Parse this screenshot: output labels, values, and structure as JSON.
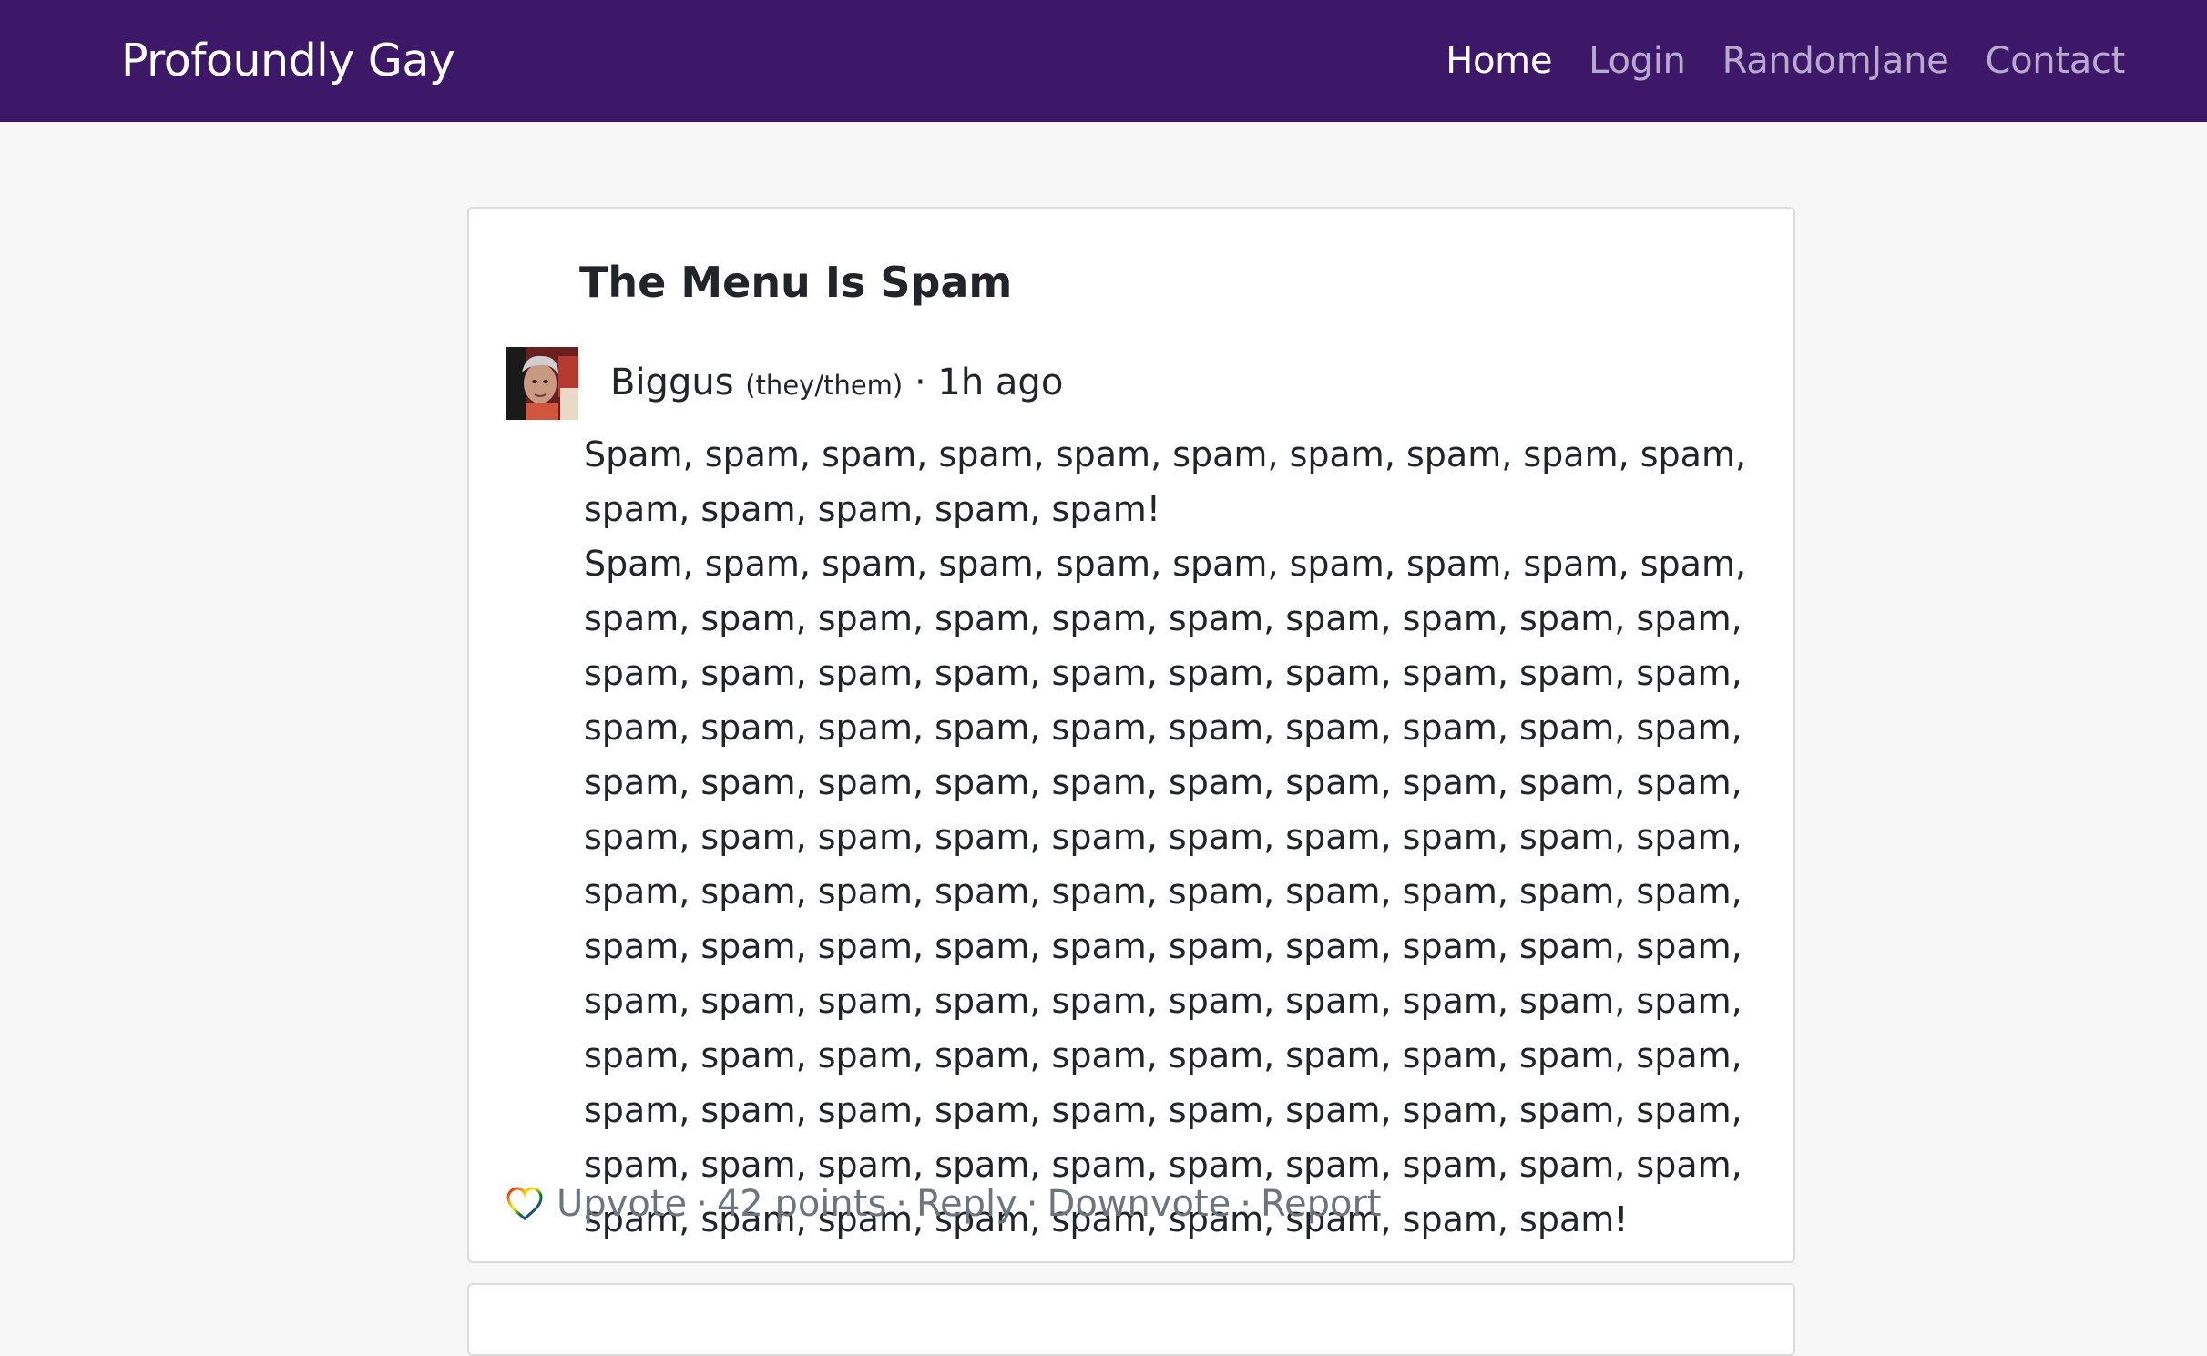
{
  "navbar": {
    "brand": "Profoundly Gay",
    "links": [
      {
        "label": "Home"
      },
      {
        "label": "Login"
      },
      {
        "label": "RandomJane"
      },
      {
        "label": "Contact"
      }
    ]
  },
  "post": {
    "title": "The Menu Is Spam",
    "author": "Biggus",
    "pronouns": "(they/them)",
    "time": "1h ago",
    "paragraphs": [
      "Spam, spam, spam, spam, spam, spam, spam, spam, spam, spam, spam, spam, spam, spam, spam!",
      "Spam, spam, spam, spam, spam, spam, spam, spam, spam, spam, spam, spam, spam, spam, spam, spam, spam, spam, spam, spam, spam, spam, spam, spam, spam, spam, spam, spam, spam, spam, spam, spam, spam, spam, spam, spam, spam, spam, spam, spam, spam, spam, spam, spam, spam, spam, spam, spam, spam, spam, spam, spam, spam, spam, spam, spam, spam, spam, spam, spam, spam, spam, spam, spam, spam, spam, spam, spam, spam, spam, spam, spam, spam, spam, spam, spam, spam, spam, spam, spam, spam, spam, spam, spam, spam, spam, spam, spam, spam, spam, spam, spam, spam, spam, spam, spam, spam, spam, spam, spam, spam, spam, spam, spam, spam, spam, spam, spam, spam, spam, spam, spam, spam, spam, spam, spam, spam, spam, spam, spam, spam, spam, spam, spam, spam, spam, spam, spam, spam!"
    ],
    "actions": {
      "upvote": "Upvote",
      "points": "42 points",
      "reply": "Reply",
      "downvote": "Downvote",
      "report": "Report",
      "separator": "·"
    },
    "heart_icon": "rainbow-heart-outline"
  },
  "colors": {
    "navbar_bg": "#3d1868",
    "nav_active": "#ffffff",
    "nav_inactive": "#b9a9cf",
    "page_bg": "#f7f7f7"
  }
}
